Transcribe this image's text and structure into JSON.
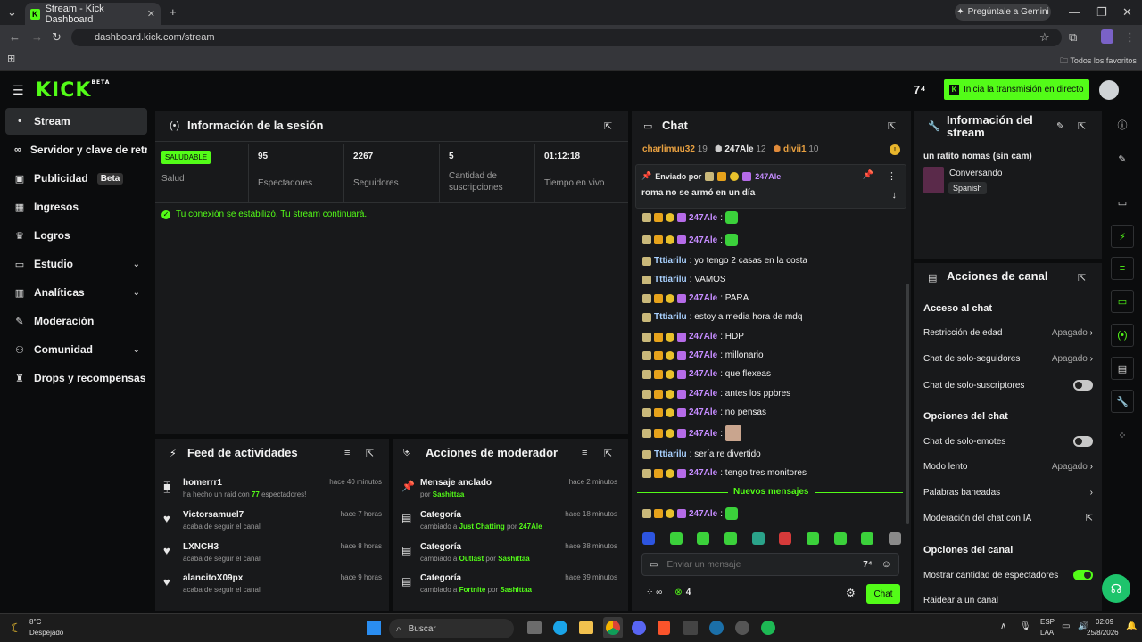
{
  "browser": {
    "tab_title": "Stream - Kick Dashboard",
    "new_tab": "+",
    "url": "dashboard.kick.com/stream",
    "gemini": "Pregúntale a Gemini",
    "favorites": "Todos los favoritos"
  },
  "header": {
    "logo": "KICK",
    "logo_sup": "BETA",
    "go_live": "Inicia la transmisión en directo"
  },
  "sidebar": {
    "items": [
      {
        "label": "Stream",
        "icon": "•"
      },
      {
        "label": "Servidor y clave de retransmisión",
        "icon": "∞"
      },
      {
        "label": "Publicidad",
        "badge": "Beta",
        "icon": "▣"
      },
      {
        "label": "Ingresos",
        "icon": "▦"
      },
      {
        "label": "Logros",
        "icon": "♛"
      },
      {
        "label": "Estudio",
        "icon": "▭"
      },
      {
        "label": "Analíticas",
        "icon": "▥"
      },
      {
        "label": "Moderación",
        "icon": "✎"
      },
      {
        "label": "Comunidad",
        "icon": "⚇"
      },
      {
        "label": "Drops y recompensas",
        "icon": "♜"
      }
    ]
  },
  "session": {
    "title": "Información de la sesión",
    "status": "SALUDABLE",
    "status_label": "Salud",
    "stats": [
      {
        "value": "95",
        "label": "Espectadores"
      },
      {
        "value": "2267",
        "label": "Seguidores"
      },
      {
        "value": "5",
        "label": "Cantidad de suscripciones"
      },
      {
        "value": "01:12:18",
        "label": "Tiempo en vivo"
      }
    ],
    "message": "Tu conexión se estabilizó. Tu stream continuará."
  },
  "feed": {
    "title": "Feed de actividades",
    "rows": [
      {
        "user": "homerrr1",
        "pre": "ha hecho un raid con",
        "count": "77",
        "post": "espectadores!",
        "time": "hace 40 minutos"
      },
      {
        "user": "Victorsamuel7",
        "desc": "acaba de seguir el canal",
        "time": "hace 7 horas"
      },
      {
        "user": "LXNCH3",
        "desc": "acaba de seguir el canal",
        "time": "hace 8 horas"
      },
      {
        "user": "alancitoX09px",
        "desc": "acaba de seguir el canal",
        "time": "hace 9 horas"
      }
    ]
  },
  "mod_actions": {
    "title": "Acciones de moderador",
    "rows": [
      {
        "title": "Mensaje anclado",
        "pre": "por",
        "user": "Sashittaa",
        "time": "hace 2 minutos"
      },
      {
        "title": "Categoría",
        "pre": "cambiado a",
        "cat": "Just Chatting",
        "mid": "por",
        "user": "247Ale",
        "time": "hace 18 minutos"
      },
      {
        "title": "Categoría",
        "pre": "cambiado a",
        "cat": "Outlast",
        "mid": "por",
        "user": "Sashittaa",
        "time": "hace 38 minutos"
      },
      {
        "title": "Categoría",
        "pre": "cambiado a",
        "cat": "Fortnite",
        "mid": "por",
        "user": "Sashittaa",
        "time": "hace 39 minutos"
      }
    ]
  },
  "chat": {
    "title": "Chat",
    "top_gifters": [
      {
        "name": "charlimuu32",
        "count": "19"
      },
      {
        "name": "247Ale",
        "count": "12"
      },
      {
        "name": "divii1",
        "count": "10"
      }
    ],
    "pinned_by": "Enviado por",
    "pinned_user": "247Ale",
    "pinned_text": "roma no se armó en un día",
    "messages": [
      {
        "user": "247Ale",
        "text": ":",
        "emote": true
      },
      {
        "user": "247Ale",
        "text": ":",
        "emote": true
      },
      {
        "user": "Tttiarilu",
        "text": ": yo tengo 2 casas en la costa",
        "plain": true
      },
      {
        "user": "Tttiarilu",
        "text": ": VAMOS",
        "plain": true
      },
      {
        "user": "247Ale",
        "text": ": PARA"
      },
      {
        "user": "Tttiarilu",
        "text": ": estoy a media hora de mdq",
        "plain": true
      },
      {
        "user": "247Ale",
        "text": ": HDP"
      },
      {
        "user": "247Ale",
        "text": ": millonario"
      },
      {
        "user": "247Ale",
        "text": ": que flexeas"
      },
      {
        "user": "247Ale",
        "text": ": antes los ppbres"
      },
      {
        "user": "247Ale",
        "text": ": no pensas"
      },
      {
        "user": "247Ale",
        "text": ":",
        "emote": true
      },
      {
        "user": "Tttiarilu",
        "text": ": sería re divertido",
        "plain": true
      },
      {
        "user": "247Ale",
        "text": ": tengo tres monitores"
      }
    ],
    "new_messages": "Nuevos mensajes",
    "last": {
      "user": "247Ale",
      "text": ":"
    },
    "input_placeholder": "Enviar un mensaje",
    "viewers": "4",
    "send": "Chat"
  },
  "stream_info": {
    "title": "Información del stream",
    "stream_title": "un ratito nomas (sin cam)",
    "category": "Conversando",
    "language": "Spanish"
  },
  "channel_actions": {
    "title": "Acciones de canal",
    "chat_access": "Acceso al chat",
    "age": {
      "label": "Restricción de edad",
      "value": "Apagado"
    },
    "followers": {
      "label": "Chat de solo-seguidores",
      "value": "Apagado"
    },
    "subs": {
      "label": "Chat de solo-suscriptores"
    },
    "chat_options": "Opciones del chat",
    "emotes": {
      "label": "Chat de solo-emotes"
    },
    "slow": {
      "label": "Modo lento",
      "value": "Apagado"
    },
    "banned": {
      "label": "Palabras baneadas"
    },
    "ai": {
      "label": "Moderación del chat con IA"
    },
    "channel_options": "Opciones del canal",
    "show_viewers": {
      "label": "Mostrar cantidad de espectadores"
    },
    "raid": {
      "label": "Raidear a un canal"
    }
  },
  "taskbar": {
    "weather_temp": "8°C",
    "weather_desc": "Despejado",
    "search": "Buscar",
    "lang1": "ESP",
    "lang2": "LAA",
    "time": "02:09",
    "date": "25/8/2026"
  },
  "colors": {
    "accent": "#53fc18",
    "panel": "#18191b",
    "bg": "#0b0c0d"
  }
}
